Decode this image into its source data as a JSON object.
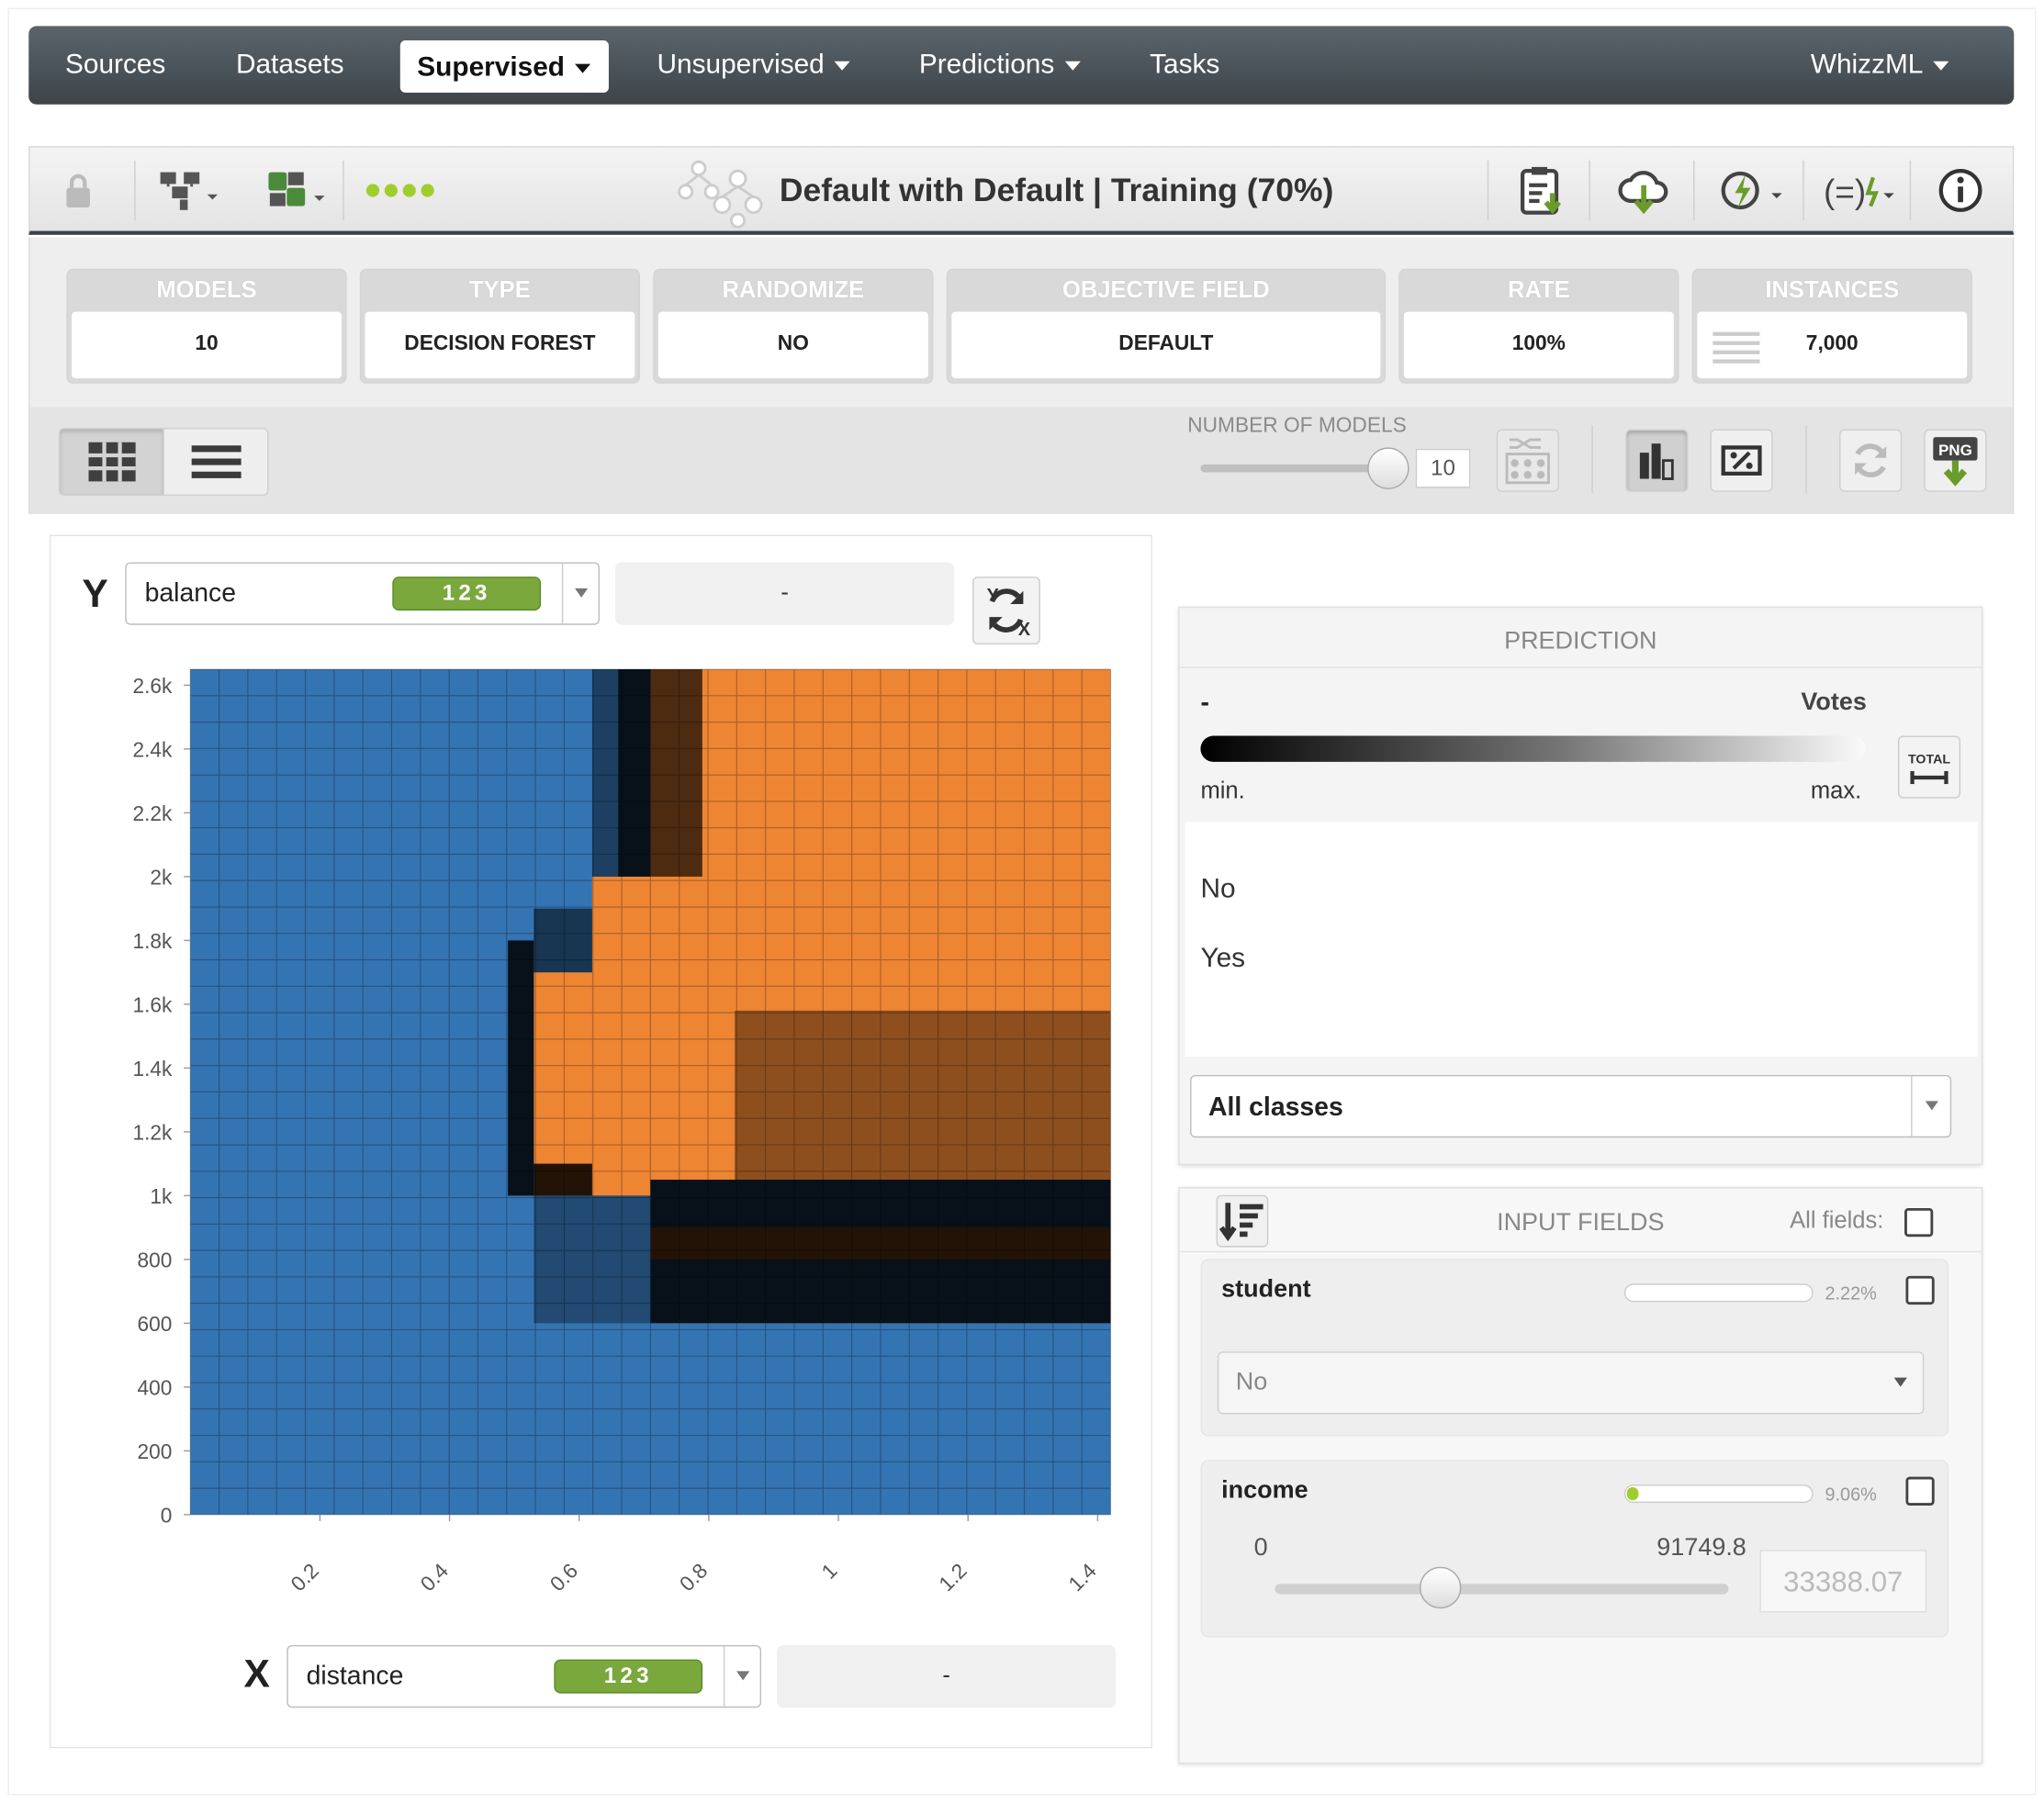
{
  "nav": {
    "items": [
      "Sources",
      "Datasets"
    ],
    "active": "Supervised",
    "items_right": [
      "Unsupervised",
      "Predictions",
      "Tasks"
    ],
    "user_menu": "WhizzML"
  },
  "toolbar": {
    "title": "Default with Default | Training (70%)"
  },
  "summary": [
    {
      "label": "MODELS",
      "value": "10"
    },
    {
      "label": "TYPE",
      "value": "DECISION FOREST"
    },
    {
      "label": "RANDOMIZE",
      "value": "NO"
    },
    {
      "label": "OBJECTIVE FIELD",
      "value": "DEFAULT"
    },
    {
      "label": "RATE",
      "value": "100%"
    },
    {
      "label": "INSTANCES",
      "value": "7,000"
    }
  ],
  "controls": {
    "num_models_label": "NUMBER OF MODELS",
    "num_models_value": "10",
    "num_models_slider": 1.0
  },
  "y_axis": {
    "letter": "Y",
    "field": "balance",
    "badge": "123",
    "secondary": "-"
  },
  "x_axis": {
    "letter": "X",
    "field": "distance",
    "badge": "123",
    "secondary": "-"
  },
  "chart_data": {
    "type": "heatmap",
    "title": "",
    "xlabel": "distance",
    "ylabel": "balance",
    "x_ticks": [
      "0.2",
      "0.4",
      "0.6",
      "0.8",
      "1",
      "1.2",
      "1.4"
    ],
    "y_ticks": [
      "0",
      "200",
      "400",
      "600",
      "800",
      "1k",
      "1.2k",
      "1.4k",
      "1.6k",
      "1.8k",
      "2k",
      "2.2k",
      "2.4k",
      "2.6k"
    ],
    "xlim": [
      0.0,
      1.42
    ],
    "ylim": [
      0,
      2650
    ],
    "grid": true,
    "classes": [
      "No",
      "Yes"
    ],
    "class_colors": {
      "No": "#3574b3",
      "Yes": "#ee8533"
    },
    "regions": [
      {
        "x": [
          0.0,
          1.42
        ],
        "y": [
          0,
          2650
        ],
        "class": "No",
        "confidence": 1.0
      },
      {
        "x": [
          0.71,
          1.42
        ],
        "y": [
          600,
          2650
        ],
        "class": "Yes",
        "confidence": 1.0
      },
      {
        "x": [
          0.62,
          0.71
        ],
        "y": [
          1000,
          2000
        ],
        "class": "Yes",
        "confidence": 1.0
      },
      {
        "x": [
          0.53,
          0.62
        ],
        "y": [
          1100,
          1700
        ],
        "class": "Yes",
        "confidence": 1.0
      },
      {
        "x": [
          0.84,
          1.42
        ],
        "y": [
          1050,
          1580
        ],
        "class": "Yes",
        "confidence": 0.55
      },
      {
        "x": [
          0.71,
          1.42
        ],
        "y": [
          600,
          1050
        ],
        "class": "No",
        "confidence": 0.05
      },
      {
        "x": [
          0.71,
          1.42
        ],
        "y": [
          800,
          900
        ],
        "class": "Yes",
        "confidence": 0.05
      },
      {
        "x": [
          0.66,
          0.71
        ],
        "y": [
          2000,
          2650
        ],
        "class": "No",
        "confidence": 0.05
      },
      {
        "x": [
          0.71,
          0.79
        ],
        "y": [
          2000,
          2650
        ],
        "class": "Yes",
        "confidence": 0.25
      },
      {
        "x": [
          0.62,
          0.66
        ],
        "y": [
          2000,
          2650
        ],
        "class": "No",
        "confidence": 0.5
      },
      {
        "x": [
          0.53,
          0.62
        ],
        "y": [
          1700,
          1900
        ],
        "class": "No",
        "confidence": 0.4
      },
      {
        "x": [
          0.53,
          0.62
        ],
        "y": [
          1000,
          1100
        ],
        "class": "Yes",
        "confidence": 0.05
      },
      {
        "x": [
          0.49,
          0.53
        ],
        "y": [
          1000,
          1800
        ],
        "class": "No",
        "confidence": 0.05
      },
      {
        "x": [
          0.53,
          0.71
        ],
        "y": [
          600,
          1000
        ],
        "class": "No",
        "confidence": 0.6
      }
    ]
  },
  "prediction": {
    "header": "PREDICTION",
    "dash": "-",
    "votes_label": "Votes",
    "min_label": "min.",
    "max_label": "max.",
    "total_label": "TOTAL",
    "classes": [
      "No",
      "Yes"
    ],
    "select_value": "All classes"
  },
  "input_fields": {
    "header": "INPUT FIELDS",
    "all_fields_label": "All fields:",
    "fields": [
      {
        "name": "student",
        "importance": "2.22%",
        "importance_value": 0.0222,
        "value": "No"
      },
      {
        "name": "income",
        "importance": "9.06%",
        "importance_value": 0.0906,
        "min": "0",
        "max": "91749.8",
        "value": "33388.07",
        "slider": 0.364
      }
    ]
  }
}
